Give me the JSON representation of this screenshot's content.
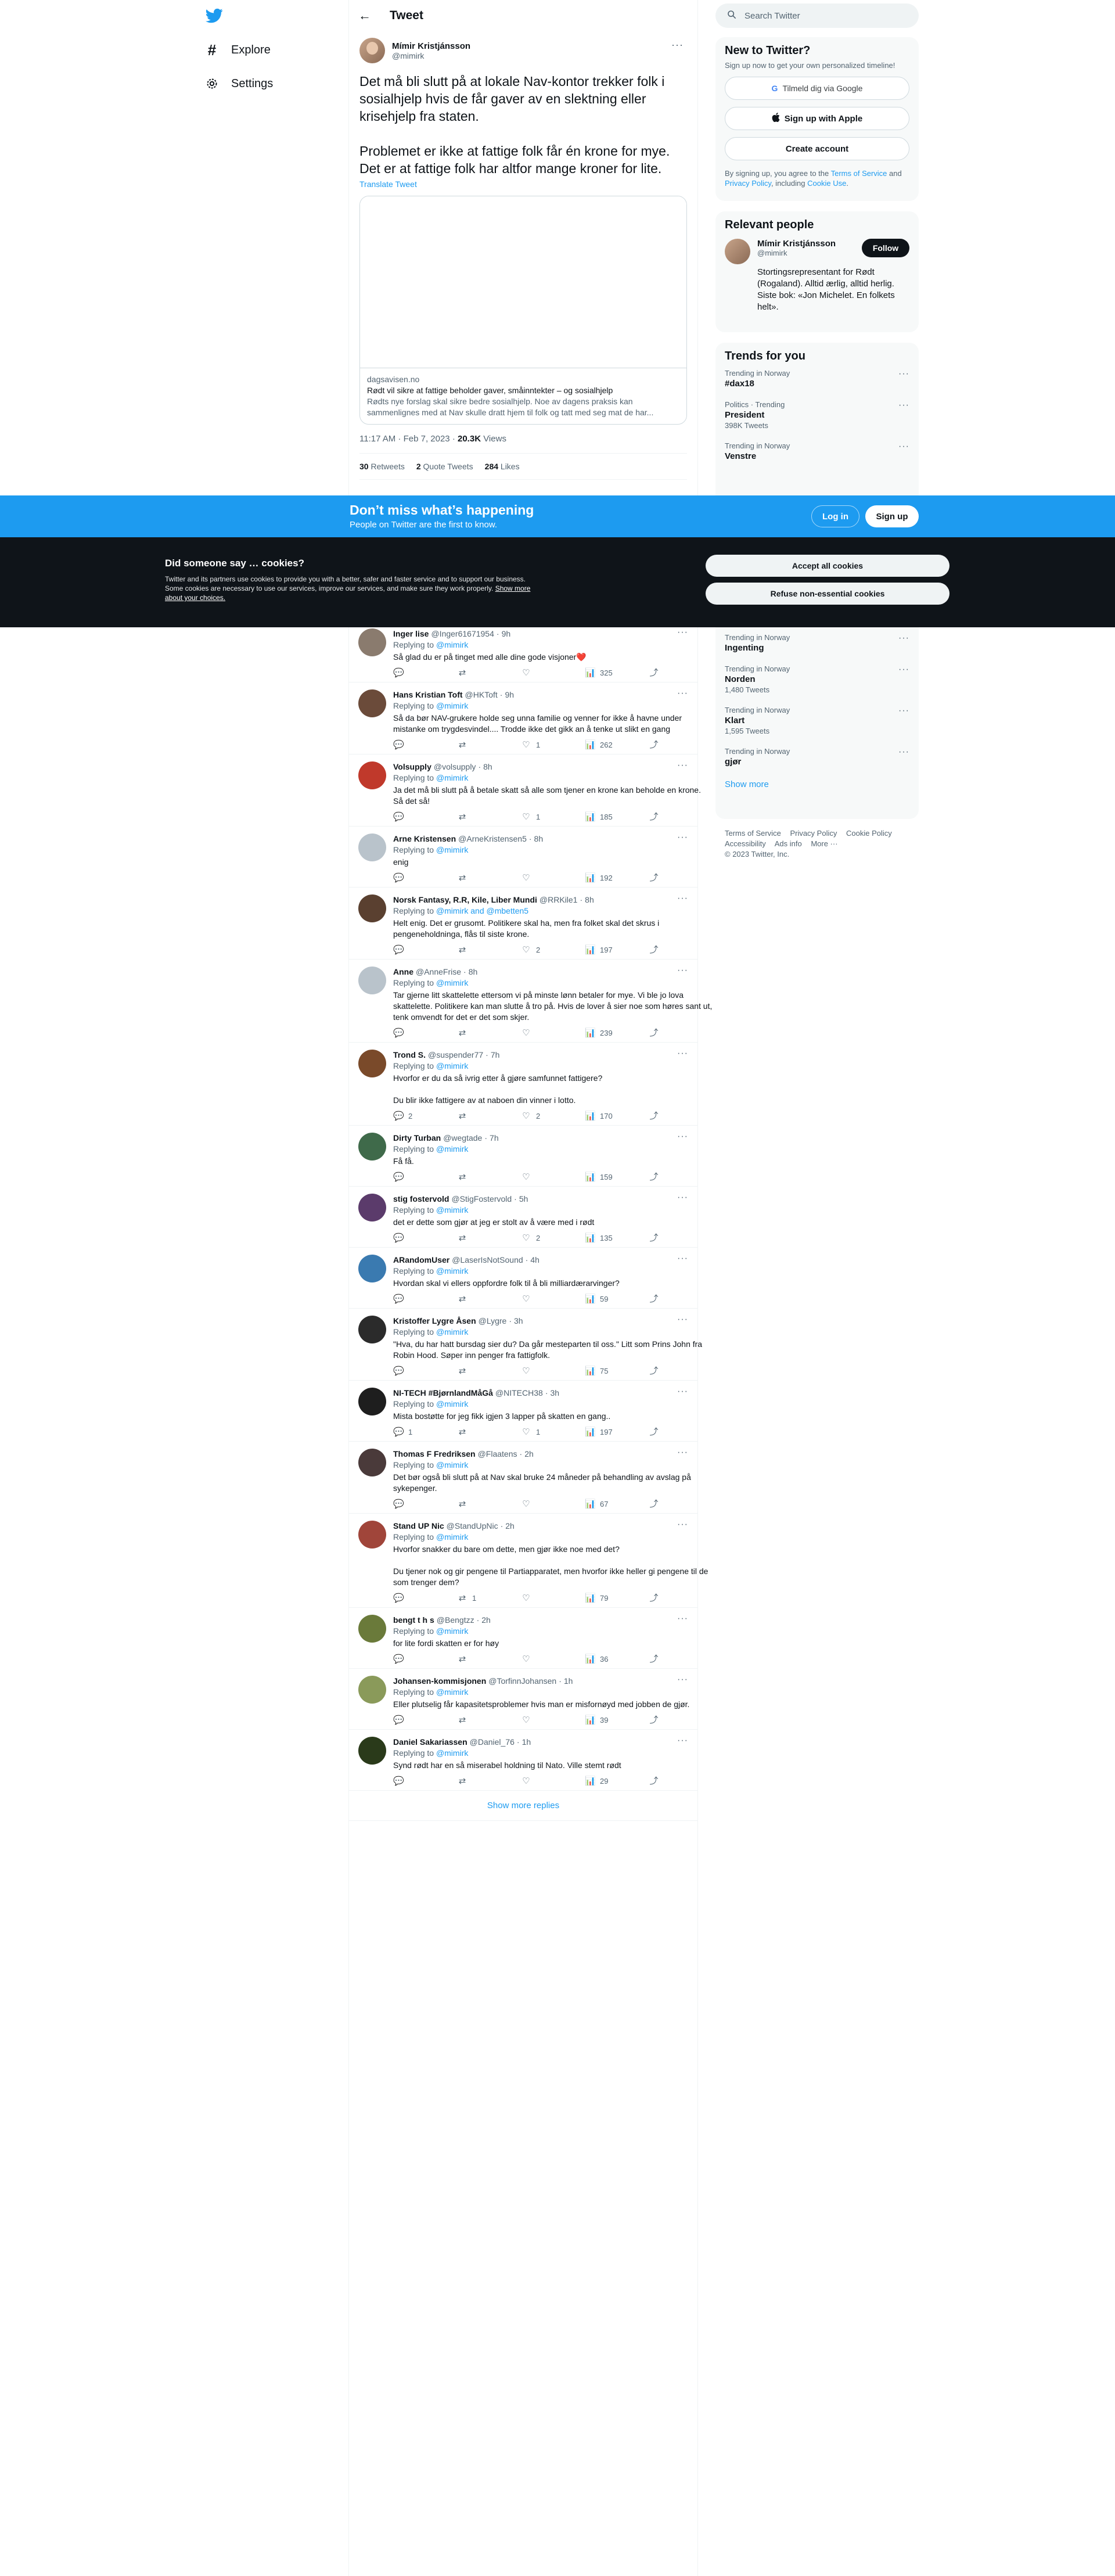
{
  "nav": {
    "explore": "Explore",
    "settings": "Settings"
  },
  "header": {
    "title": "Tweet"
  },
  "tweet": {
    "author_name": "Mímir Kristjánsson",
    "author_handle": "@mimirk",
    "text": "Det må bli slutt på at lokale Nav-kontor trekker folk i sosialhjelp hvis de får gaver av en slektning eller krisehjelp fra staten.\n\nProblemet er ikke at fattige folk får én krone for mye. Det er at fattige folk har altfor mange kroner for lite.",
    "translate": "Translate Tweet",
    "card": {
      "domain": "dagsavisen.no",
      "title": "Rødt vil sikre at fattige beholder gaver, småinntekter – og sosialhjelp",
      "description": "Rødts nye forslag skal sikre bedre sosialhjelp. Noe av dagens praksis kan sammenlignes med at Nav skulle dratt hjem til folk og tatt med seg mat de har..."
    },
    "time": "11:17 AM · Feb 7, 2023",
    "views_count": "20.3K",
    "views_label": "Views",
    "retweets_count": "30",
    "retweets_label": "Retweets",
    "quotes_count": "2",
    "quotes_label": "Quote Tweets",
    "likes_count": "284",
    "likes_label": "Likes"
  },
  "replies": [
    {
      "name": "Inger lise",
      "handle": "@Inger61671954",
      "time": "9h",
      "replying_prefix": "Replying to ",
      "replying_to": "@mimirk",
      "text": "Så glad du er på tinget med alle dine gode visjoner❤️",
      "replies": "",
      "retweets": "",
      "likes": "",
      "views": "325",
      "avatar_color": "#8a7b6e"
    },
    {
      "name": "Hans Kristian Toft",
      "handle": "@HKToft",
      "time": "9h",
      "replying_prefix": "Replying to ",
      "replying_to": "@mimirk",
      "text": "Så da bør NAV-grukere holde seg unna familie og venner for ikke å havne under mistanke om trygdesvindel.... Trodde ikke det gikk an å tenke ut slikt en gang",
      "replies": "",
      "retweets": "",
      "likes": "1",
      "views": "262",
      "avatar_color": "#6b4b3a"
    },
    {
      "name": "Volsupply",
      "handle": "@volsupply",
      "time": "8h",
      "replying_prefix": "Replying to ",
      "replying_to": "@mimirk",
      "text": "Ja det må bli slutt på å betale skatt så alle som tjener en krone kan beholde en krone. Så det så!",
      "replies": "",
      "retweets": "",
      "likes": "1",
      "views": "185",
      "avatar_color": "#c0392b"
    },
    {
      "name": "Arne Kristensen",
      "handle": "@ArneKristensen5",
      "time": "8h",
      "replying_prefix": "Replying to ",
      "replying_to": "@mimirk",
      "text": "enig",
      "replies": "",
      "retweets": "",
      "likes": "",
      "views": "192",
      "avatar_color": "#b9c3cb"
    },
    {
      "name": "Norsk Fantasy, R.R, Kile, Liber Mundi",
      "handle": "@RRKile1",
      "time": "8h",
      "replying_prefix": "Replying to ",
      "replying_to": "@mimirk and @mbetten5",
      "text": "Helt enig. Det er grusomt. Politikere skal ha, men fra folket skal det skrus i pengeneholdninga, flås til siste krone.",
      "replies": "",
      "retweets": "",
      "likes": "2",
      "views": "197",
      "avatar_color": "#5a4030"
    },
    {
      "name": "Anne",
      "handle": "@AnneFrise",
      "time": "8h",
      "replying_prefix": "Replying to ",
      "replying_to": "@mimirk",
      "text": "Tar gjerne litt skattelette ettersom vi på minste lønn betaler for mye. Vi ble jo lova skattelette. Politikere kan man slutte å tro på. Hvis de lover å sier noe som høres sant ut, tenk omvendt for det er det som skjer.",
      "replies": "",
      "retweets": "",
      "likes": "",
      "views": "239",
      "avatar_color": "#b9c3cb"
    },
    {
      "name": "Trond S.",
      "handle": "@suspender77",
      "time": "7h",
      "replying_prefix": "Replying to ",
      "replying_to": "@mimirk",
      "text": "Hvorfor er du da så ivrig etter å gjøre samfunnet fattigere?\n\nDu blir ikke fattigere av at naboen din vinner i lotto.",
      "replies": "2",
      "retweets": "",
      "likes": "2",
      "views": "170",
      "avatar_color": "#7a4a2a"
    },
    {
      "name": "Dirty Turban",
      "handle": "@wegtade",
      "time": "7h",
      "replying_prefix": "Replying to ",
      "replying_to": "@mimirk",
      "text": "Få få.",
      "replies": "",
      "retweets": "",
      "likes": "",
      "views": "159",
      "avatar_color": "#3f6a4a"
    },
    {
      "name": "stig fostervold",
      "handle": "@StigFostervold",
      "time": "5h",
      "replying_prefix": "Replying to ",
      "replying_to": "@mimirk",
      "text": "det er dette som gjør at jeg er stolt av å være med i rødt",
      "replies": "",
      "retweets": "",
      "likes": "2",
      "views": "135",
      "avatar_color": "#5b3b6b"
    },
    {
      "name": "ARandomUser",
      "handle": "@LaserIsNotSound",
      "time": "4h",
      "replying_prefix": "Replying to ",
      "replying_to": "@mimirk",
      "text": "Hvordan skal vi ellers oppfordre folk til å bli milliardærarvinger?",
      "replies": "",
      "retweets": "",
      "likes": "",
      "views": "59",
      "avatar_color": "#3a7ab0"
    },
    {
      "name": "Kristoffer Lygre Åsen",
      "handle": "@Lygre",
      "time": "3h",
      "replying_prefix": "Replying to ",
      "replying_to": "@mimirk",
      "text": "\"Hva, du har hatt bursdag sier du? Da går mesteparten til oss.\" Litt som Prins John fra Robin Hood. Søper inn penger fra fattigfolk.",
      "replies": "",
      "retweets": "",
      "likes": "",
      "views": "75",
      "avatar_color": "#2b2b2b"
    },
    {
      "name": "NI-TECH #BjørnlandMåGå",
      "handle": "@NITECH38",
      "time": "3h",
      "replying_prefix": "Replying to ",
      "replying_to": "@mimirk",
      "text": "Mista bostøtte for jeg fikk igjen 3 lapper på skatten en gang..",
      "replies": "1",
      "retweets": "",
      "likes": "1",
      "views": "197",
      "avatar_color": "#1e1e1e"
    },
    {
      "name": "Thomas F Fredriksen",
      "handle": "@Flaatens",
      "time": "2h",
      "replying_prefix": "Replying to ",
      "replying_to": "@mimirk",
      "text": "Det bør også bli slutt på at Nav skal bruke 24 måneder på behandling av avslag på sykepenger.",
      "replies": "",
      "retweets": "",
      "likes": "",
      "views": "67",
      "avatar_color": "#4a3a3a"
    },
    {
      "name": "Stand UP Nic",
      "handle": "@StandUpNic",
      "time": "2h",
      "replying_prefix": "Replying to ",
      "replying_to": "@mimirk",
      "text": "Hvorfor snakker du bare om dette, men gjør ikke noe med det?\n\nDu tjener nok og gir pengene til Partiapparatet, men hvorfor ikke heller gi pengene til de som trenger dem?",
      "replies": "",
      "retweets": "1",
      "likes": "",
      "views": "79",
      "avatar_color": "#a0453a"
    },
    {
      "name": "bengt t h s",
      "handle": "@Bengtzz",
      "time": "2h",
      "replying_prefix": "Replying to ",
      "replying_to": "@mimirk",
      "text": "for lite fordi  skatten er for høy",
      "replies": "",
      "retweets": "",
      "likes": "",
      "views": "36",
      "avatar_color": "#6a7a3a"
    },
    {
      "name": "Johansen-kommisjonen",
      "handle": "@TorfinnJohansen",
      "time": "1h",
      "replying_prefix": "Replying to ",
      "replying_to": "@mimirk",
      "text": "Eller plutselig får kapasitetsproblemer hvis man er misfornøyd med jobben de gjør.",
      "replies": "",
      "retweets": "",
      "likes": "",
      "views": "39",
      "avatar_color": "#8a9a5a"
    },
    {
      "name": "Daniel Sakariassen",
      "handle": "@Daniel_76",
      "time": "1h",
      "replying_prefix": "Replying to ",
      "replying_to": "@mimirk",
      "text": "Synd rødt har en så miserabel holdning til Nato. Ville stemt rødt",
      "replies": "",
      "retweets": "",
      "likes": "",
      "views": "29",
      "avatar_color": "#2a3a1a"
    }
  ],
  "show_more_replies": "Show more replies",
  "search": {
    "placeholder": "Search Twitter"
  },
  "new_to_twitter": {
    "title": "New to Twitter?",
    "subtitle": "Sign up now to get your own personalized timeline!",
    "google_btn": "Tilmeld dig via Google",
    "apple_btn": "Sign up with Apple",
    "create_btn": "Create account",
    "terms_prefix": "By signing up, you agree to the ",
    "terms_link": "Terms of Service",
    "terms_mid": " and ",
    "privacy_link": "Privacy Policy",
    "terms_mid2": ", including ",
    "cookie_link": "Cookie Use",
    "terms_end": "."
  },
  "relevant_people": {
    "title": "Relevant people",
    "name": "Mímir Kristjánsson",
    "handle": "@mimirk",
    "follow": "Follow",
    "bio": "Stortingsrepresentant for Rødt (Rogaland). Alltid ærlig, alltid herlig. Siste bok: «Jon Michelet. En folkets helt»."
  },
  "trends": {
    "title": "Trends for you",
    "top": [
      {
        "label": "Trending in Norway",
        "name": "#dax18",
        "count": ""
      },
      {
        "label": "Politics · Trending",
        "name": "President",
        "count": "398K Tweets"
      },
      {
        "label": "Trending in Norway",
        "name": "Venstre",
        "count": ""
      }
    ],
    "bottom": [
      {
        "label": "Trending in Norway",
        "name": "Ingenting",
        "count": ""
      },
      {
        "label": "Trending in Norway",
        "name": "Norden",
        "count": "1,480 Tweets"
      },
      {
        "label": "Trending in Norway",
        "name": "Klart",
        "count": "1,595 Tweets"
      },
      {
        "label": "Trending in Norway",
        "name": "gjør",
        "count": ""
      }
    ],
    "show_more": "Show more"
  },
  "footer": {
    "terms": "Terms of Service",
    "privacy": "Privacy Policy",
    "cookie": "Cookie Policy",
    "accessibility": "Accessibility",
    "ads": "Ads info",
    "more": "More ···",
    "copyright": "© 2023 Twitter, Inc."
  },
  "promo": {
    "title": "Don’t miss what’s happening",
    "subtitle": "People on Twitter are the first to know.",
    "login": "Log in",
    "signup": "Sign up"
  },
  "cookies": {
    "title": "Did someone say … cookies?",
    "text": "Twitter and its partners use cookies to provide you with a better, safer and faster service and to support our business. Some cookies are necessary to use our services, improve our services, and make sure they work properly. ",
    "link": "Show more about your choices.",
    "accept": "Accept all cookies",
    "refuse": "Refuse non-essential cookies"
  },
  "colors": {
    "accent": "#1d9bf0",
    "text": "#0f1419",
    "muted": "#536471",
    "dark": "#0f1419"
  }
}
